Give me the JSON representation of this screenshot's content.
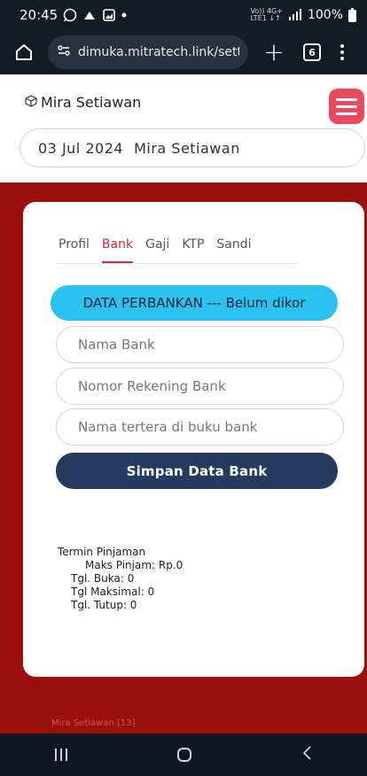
{
  "status_bar": {
    "time": "20:45",
    "network_top": "Vo)) 4G+",
    "network_bottom": "LTE1 ↓↑",
    "battery": "100%"
  },
  "browser": {
    "url": "dimuka.mitratech.link/settir",
    "tab_count": "6"
  },
  "header": {
    "user_name": "Mira Setiawan",
    "date": "03 Jul 2024",
    "date_user": "Mira Setiawan"
  },
  "tabs": [
    "Profil",
    "Bank",
    "Gaji",
    "KTP",
    "Sandi"
  ],
  "active_tab": "Bank",
  "bank_form": {
    "banner": "DATA PERBANKAN --- Belum dikor",
    "bank_name_placeholder": "Nama Bank",
    "account_number_placeholder": "Nomor Rekening Bank",
    "account_holder_placeholder": "Nama tertera di buku bank",
    "save_label": "Simpan Data Bank"
  },
  "loan_terms": {
    "title": "Termin Pinjaman",
    "max": "Maks Pinjam: Rp.0",
    "open_date": "Tgl. Buka: 0",
    "max_date": "Tgl Maksimal: 0",
    "close_date": "Tgl. Tutup: 0"
  },
  "footer": {
    "text": "Mira Setiawan [13]"
  },
  "colors": {
    "status_bar_bg": "#141a26",
    "accent_red": "#9b0f0d",
    "hamburger_bg": "#e84a5f",
    "banner_bg": "#2bc2ef",
    "save_button_bg": "#243a5e",
    "active_tab": "#d02b3a"
  },
  "icons": {
    "status": [
      "whatsapp-icon",
      "notification-icon",
      "gallery-icon"
    ],
    "browser": [
      "home-icon",
      "site-settings-icon",
      "new-tab-icon",
      "tabs-icon",
      "more-menu-icon"
    ],
    "brand": "box-icon",
    "menu": "hamburger-icon"
  }
}
